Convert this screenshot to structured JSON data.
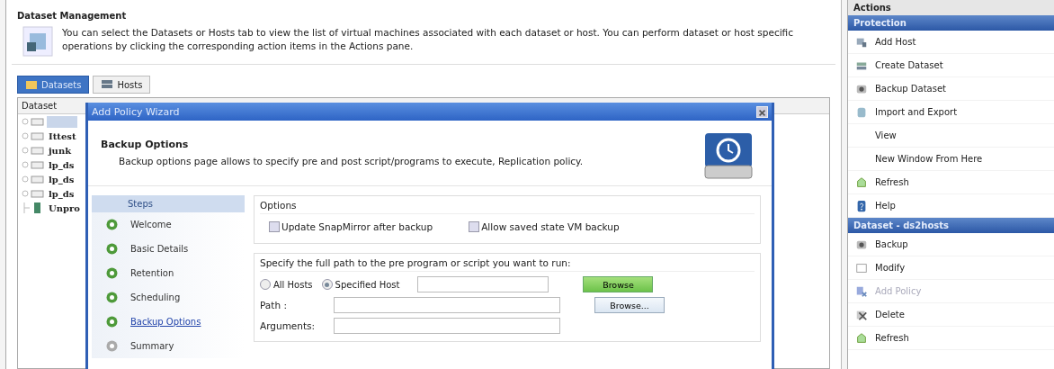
{
  "main": {
    "title": "Dataset Management",
    "description": "You can select the Datasets or Hosts tab to view the list of virtual machines associated with each dataset or host. You can perform dataset or host specific operations by clicking the corresponding action items in the Actions pane.",
    "tabs": [
      {
        "label": "Datasets",
        "selected": true
      },
      {
        "label": "Hosts",
        "selected": false
      }
    ],
    "tree": {
      "column": "Dataset",
      "items": [
        {
          "kind": "dataset",
          "selected": true
        },
        {
          "label": "Ittest",
          "kind": "dataset",
          "selected": false
        },
        {
          "label": "junk",
          "kind": "dataset",
          "selected": false
        },
        {
          "label": "lp_ds",
          "kind": "dataset",
          "selected": false
        },
        {
          "label": "lp_ds",
          "kind": "dataset",
          "selected": false
        },
        {
          "label": "lp_ds",
          "kind": "dataset",
          "selected": false
        },
        {
          "label": "Unpro",
          "kind": "unprotected",
          "selected": false
        }
      ]
    }
  },
  "dialog": {
    "title": "Add Policy Wizard",
    "heading": "Backup Options",
    "subtitle": "Backup options page allows to specify pre and post script/programs to execute, Replication policy.",
    "steps_title": "Steps",
    "steps": [
      {
        "label": "Welcome",
        "done": true,
        "selected": false
      },
      {
        "label": "Basic Details",
        "done": true,
        "selected": false
      },
      {
        "label": "Retention",
        "done": true,
        "selected": false
      },
      {
        "label": "Scheduling",
        "done": true,
        "selected": false
      },
      {
        "label": "Backup Options",
        "done": true,
        "selected": true
      },
      {
        "label": "Summary",
        "done": false,
        "selected": false
      }
    ],
    "options": {
      "title": "Options",
      "checkboxes": [
        {
          "label": "Update SnapMirror after backup",
          "checked": false
        },
        {
          "label": "Allow saved state VM backup",
          "checked": false
        }
      ]
    },
    "script": {
      "title": "Specify the full path to the pre program or script you want to run:",
      "radios": [
        {
          "label": "All Hosts",
          "selected": false
        },
        {
          "label": "Specified Host",
          "selected": true
        }
      ],
      "host_browse": {
        "label": "Browse",
        "highlighted": true
      },
      "path_label": "Path :",
      "path_browse": {
        "label": "Browse...",
        "highlighted": false
      },
      "arguments_label": "Arguments:"
    }
  },
  "actions": {
    "title": "Actions",
    "sections": [
      {
        "title": "Protection",
        "items": [
          {
            "label": "Add Host",
            "kind": "host",
            "disabled": false
          },
          {
            "label": "Create Dataset",
            "kind": "dataset",
            "disabled": false
          },
          {
            "label": "Backup Dataset",
            "kind": "backup",
            "disabled": false
          },
          {
            "label": "Import and Export",
            "kind": "import",
            "disabled": false
          },
          {
            "label": "View",
            "kind": "plain",
            "disabled": false
          },
          {
            "label": "New Window From Here",
            "kind": "plain",
            "disabled": false
          },
          {
            "label": "Refresh",
            "kind": "refresh",
            "disabled": false
          },
          {
            "label": "Help",
            "kind": "help",
            "disabled": false
          }
        ]
      },
      {
        "title": "Dataset - ds2hosts",
        "items": [
          {
            "label": "Backup",
            "kind": "backup",
            "disabled": false
          },
          {
            "label": "Modify",
            "kind": "modify",
            "disabled": false
          },
          {
            "label": "Add Policy",
            "kind": "policy",
            "disabled": true
          },
          {
            "label": "Delete",
            "kind": "delete",
            "disabled": false
          },
          {
            "label": "Refresh",
            "kind": "refresh",
            "disabled": false
          }
        ]
      }
    ]
  }
}
